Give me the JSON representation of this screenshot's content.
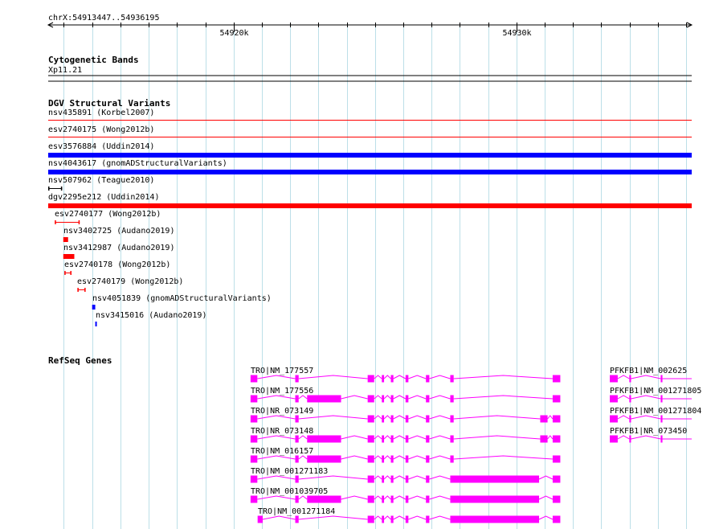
{
  "location": {
    "label": "chrX:54913447..54936195",
    "start": 54913447,
    "end": 54936195,
    "ticks": [
      {
        "pos": 54920000,
        "label": "54920k"
      },
      {
        "pos": 54930000,
        "label": "54930k"
      }
    ]
  },
  "cytobands": {
    "title": "Cytogenetic Bands",
    "band": "Xp11.21"
  },
  "dgv": {
    "title": "DGV Structural Variants",
    "colors": {
      "loss": "#ff0000",
      "gain": "#0000ff",
      "complex": "#000000"
    },
    "features": [
      {
        "label": "nsv435891 (Korbel2007)",
        "start": 54913447,
        "end": 54936195,
        "color": "loss",
        "style": "thin"
      },
      {
        "label": "esv2740175 (Wong2012b)",
        "start": 54913447,
        "end": 54936195,
        "color": "loss",
        "style": "thin"
      },
      {
        "label": "esv3576884 (Uddin2014)",
        "start": 54913447,
        "end": 54936195,
        "color": "gain",
        "style": "thick"
      },
      {
        "label": "nsv4043617 (gnomADStructuralVariants)",
        "start": 54913447,
        "end": 54936195,
        "color": "gain",
        "style": "thick"
      },
      {
        "label": "nsv507962 (Teague2010)",
        "start": 54913447,
        "end": 54913940,
        "color": "complex",
        "style": "bracket"
      },
      {
        "label": "dgv2295e212 (Uddin2014)",
        "start": 54913447,
        "end": 54936195,
        "color": "loss",
        "style": "thick"
      },
      {
        "label": "esv2740177 (Wong2012b)",
        "start": 54913680,
        "end": 54914560,
        "color": "loss",
        "style": "bracket"
      },
      {
        "label": "nsv3402725 (Audano2019)",
        "start": 54913980,
        "end": 54914150,
        "color": "loss",
        "style": "block"
      },
      {
        "label": "nsv3412987 (Audano2019)",
        "start": 54913980,
        "end": 54914370,
        "color": "loss",
        "style": "block"
      },
      {
        "label": "esv2740178 (Wong2012b)",
        "start": 54914020,
        "end": 54914270,
        "color": "loss",
        "style": "bracket"
      },
      {
        "label": "esv2740179 (Wong2012b)",
        "start": 54914480,
        "end": 54914770,
        "color": "loss",
        "style": "bracket"
      },
      {
        "label": "nsv4051839 (gnomADStructuralVariants)",
        "start": 54915000,
        "end": 54915110,
        "color": "gain",
        "style": "block"
      },
      {
        "label": "nsv3415016 (Audano2019)",
        "start": 54915110,
        "end": 54915165,
        "color": "gain",
        "style": "block"
      }
    ]
  },
  "refseq": {
    "title": "RefSeq Genes",
    "color": "#ff00ff",
    "transcripts": [
      {
        "label": "TRO|NM_177557",
        "start": 54920600,
        "end": 54931550,
        "exons": [
          [
            54920600,
            54920840
          ],
          [
            54922180,
            54922300
          ],
          [
            54924740,
            54924970
          ],
          [
            54925240,
            54925320
          ],
          [
            54925560,
            54925650
          ],
          [
            54926080,
            54926180
          ],
          [
            54926800,
            54926920
          ],
          [
            54927660,
            54927780
          ],
          [
            54931280,
            54931550
          ]
        ]
      },
      {
        "label": "TRO|NM_177556",
        "start": 54920600,
        "end": 54931550,
        "exons": [
          [
            54920600,
            54920840
          ],
          [
            54922180,
            54922300
          ],
          [
            54922600,
            54923800
          ],
          [
            54924740,
            54924970
          ],
          [
            54925240,
            54925320
          ],
          [
            54925560,
            54925650
          ],
          [
            54926080,
            54926180
          ],
          [
            54926800,
            54926920
          ],
          [
            54927660,
            54927780
          ],
          [
            54931280,
            54931550
          ]
        ]
      },
      {
        "label": "TRO|NR_073149",
        "start": 54920600,
        "end": 54931550,
        "exons": [
          [
            54920600,
            54920840
          ],
          [
            54922180,
            54922300
          ],
          [
            54924740,
            54924970
          ],
          [
            54925240,
            54925320
          ],
          [
            54925560,
            54925650
          ],
          [
            54926080,
            54926180
          ],
          [
            54926800,
            54926920
          ],
          [
            54927660,
            54927780
          ],
          [
            54930840,
            54931100
          ],
          [
            54931280,
            54931550
          ]
        ]
      },
      {
        "label": "TRO|NR_073148",
        "start": 54920600,
        "end": 54931550,
        "exons": [
          [
            54920600,
            54920840
          ],
          [
            54922180,
            54922300
          ],
          [
            54922600,
            54923800
          ],
          [
            54924740,
            54924970
          ],
          [
            54925240,
            54925320
          ],
          [
            54925560,
            54925650
          ],
          [
            54926080,
            54926180
          ],
          [
            54926800,
            54926920
          ],
          [
            54927660,
            54927780
          ],
          [
            54930840,
            54931100
          ],
          [
            54931280,
            54931550
          ]
        ]
      },
      {
        "label": "TRO|NM_016157",
        "start": 54920600,
        "end": 54931550,
        "exons": [
          [
            54920600,
            54920840
          ],
          [
            54922180,
            54922300
          ],
          [
            54922600,
            54923800
          ],
          [
            54924740,
            54924970
          ],
          [
            54925240,
            54925320
          ],
          [
            54925560,
            54925650
          ],
          [
            54926080,
            54926180
          ],
          [
            54926800,
            54926920
          ],
          [
            54927660,
            54927780
          ],
          [
            54931280,
            54931550
          ]
        ]
      },
      {
        "label": "TRO|NM_001271183",
        "start": 54920600,
        "end": 54931550,
        "exons": [
          [
            54920600,
            54920840
          ],
          [
            54922180,
            54922300
          ],
          [
            54924740,
            54924970
          ],
          [
            54925240,
            54925320
          ],
          [
            54925560,
            54925650
          ],
          [
            54926080,
            54926180
          ],
          [
            54926800,
            54926920
          ],
          [
            54927660,
            54930800
          ],
          [
            54931280,
            54931550
          ]
        ]
      },
      {
        "label": "TRO|NM_001039705",
        "start": 54920600,
        "end": 54931550,
        "exons": [
          [
            54920600,
            54920840
          ],
          [
            54922180,
            54922300
          ],
          [
            54922600,
            54923800
          ],
          [
            54924740,
            54924970
          ],
          [
            54925240,
            54925320
          ],
          [
            54925560,
            54925650
          ],
          [
            54926080,
            54926180
          ],
          [
            54926800,
            54926920
          ],
          [
            54927660,
            54930800
          ],
          [
            54931280,
            54931550
          ]
        ]
      },
      {
        "label": "TRO|NM_001271184",
        "start": 54920850,
        "end": 54931550,
        "exons": [
          [
            54920850,
            54921030
          ],
          [
            54922180,
            54922300
          ],
          [
            54924740,
            54924970
          ],
          [
            54925240,
            54925320
          ],
          [
            54925560,
            54925650
          ],
          [
            54926080,
            54926180
          ],
          [
            54926800,
            54926920
          ],
          [
            54927660,
            54930800
          ],
          [
            54931280,
            54931550
          ]
        ]
      },
      {
        "label": "PFKFB1|NM_002625",
        "start": 54933300,
        "end": 54936195,
        "exons": [
          [
            54933300,
            54933580
          ],
          [
            54933990,
            54934050
          ],
          [
            54935100,
            54935160
          ]
        ]
      },
      {
        "label": "PFKFB1|NM_001271805",
        "start": 54933300,
        "end": 54936195,
        "exons": [
          [
            54933300,
            54933580
          ],
          [
            54933990,
            54934050
          ],
          [
            54935100,
            54935160
          ]
        ]
      },
      {
        "label": "PFKFB1|NM_001271804",
        "start": 54933300,
        "end": 54936195,
        "exons": [
          [
            54933300,
            54933580
          ],
          [
            54933990,
            54934050
          ],
          [
            54935100,
            54935160
          ]
        ]
      },
      {
        "label": "PFKFB1|NR_073450",
        "start": 54933300,
        "end": 54936195,
        "exons": [
          [
            54933300,
            54933580
          ],
          [
            54933990,
            54934050
          ],
          [
            54935100,
            54935160
          ]
        ]
      }
    ]
  }
}
